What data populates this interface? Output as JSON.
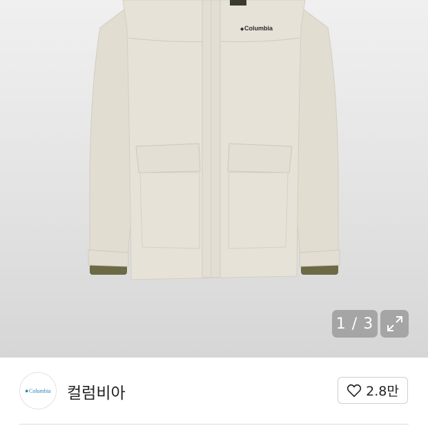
{
  "gallery": {
    "product_image_alt": "jacket",
    "jacket_chest_logo": "Columbia",
    "page_indicator": "1 / 3",
    "icons": {
      "expand": "expand-icon"
    }
  },
  "brand": {
    "logo_text": "Columbia",
    "name": "컬럼비아",
    "like_count": "2.8만",
    "icons": {
      "like": "heart-outline-icon"
    }
  },
  "colors": {
    "jacket": "#e6e1d6",
    "cuff": "#6b6a45",
    "logo_blue": "#1f7fb8"
  }
}
